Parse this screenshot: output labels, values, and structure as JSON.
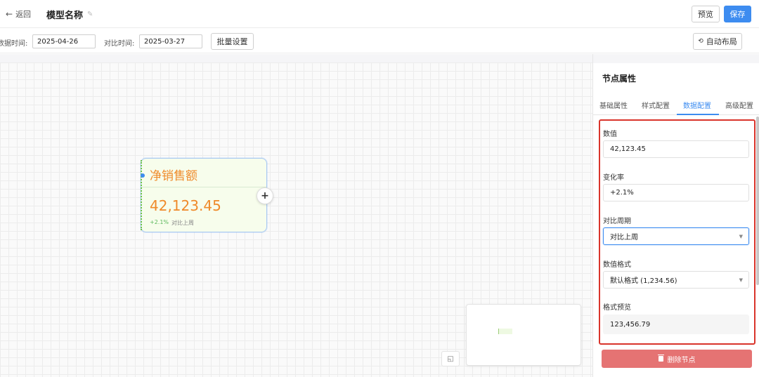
{
  "header": {
    "back_label": "返回",
    "model_title": "模型名称",
    "preview_label": "预览",
    "save_label": "保存"
  },
  "toolbar": {
    "data_time_label": "数据时间:",
    "data_time_value": "2025-04-26",
    "compare_time_label": "对比时间:",
    "compare_time_value": "2025-03-27",
    "batch_label": "批量设置",
    "auto_layout_label": "自动布局"
  },
  "node": {
    "title": "净销售额",
    "value": "42,123.45",
    "change": "+2.1%",
    "compare": "对比上周",
    "add_symbol": "+"
  },
  "panel": {
    "title": "节点属性",
    "tabs": [
      {
        "label": "基础属性",
        "active": false
      },
      {
        "label": "样式配置",
        "active": false
      },
      {
        "label": "数据配置",
        "active": true
      },
      {
        "label": "高级配置",
        "active": false
      }
    ],
    "fields": {
      "value_label": "数值",
      "value": "42,123.45",
      "rate_label": "变化率",
      "rate": "+2.1%",
      "period_label": "对比周期",
      "period": "对比上周",
      "format_label": "数值格式",
      "format": "默认格式 (1,234.56)",
      "preview_label": "格式预览",
      "preview": "123,456.79"
    },
    "delete_label": "删除节点"
  },
  "colors": {
    "primary": "#3d8cf0",
    "node_accent": "#ef8a2a",
    "node_bg": "#f7fdec",
    "positive": "#5cb85c",
    "danger": "#e57373",
    "highlight_border": "#d9342b"
  }
}
